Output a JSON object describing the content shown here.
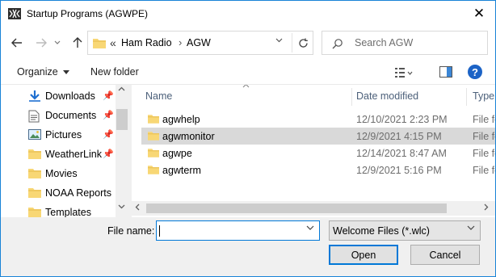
{
  "window": {
    "title": "Startup Programs (AGWPE)",
    "close_glyph": "✕"
  },
  "nav": {
    "back_icon": "arrow-left-icon",
    "forward_icon": "arrow-right-icon",
    "recent_icon": "chevron-down-icon",
    "up_icon": "arrow-up-icon",
    "breadcrumb_overflow": "«",
    "breadcrumb": [
      "Ham Radio",
      "AGW"
    ],
    "breadcrumb_separator": "›",
    "search_placeholder": "Search AGW"
  },
  "toolbar": {
    "organize_label": "Organize",
    "new_folder_label": "New folder",
    "help_label": "?"
  },
  "sidebar": {
    "items": [
      {
        "label": "Downloads",
        "icon": "downloads-icon",
        "pinned": true
      },
      {
        "label": "Documents",
        "icon": "documents-icon",
        "pinned": true
      },
      {
        "label": "Pictures",
        "icon": "pictures-icon",
        "pinned": true
      },
      {
        "label": "WeatherLink",
        "icon": "folder-icon",
        "pinned": true
      },
      {
        "label": "Movies",
        "icon": "folder-icon",
        "pinned": false
      },
      {
        "label": "NOAA Reports",
        "icon": "folder-icon",
        "pinned": false
      },
      {
        "label": "Templates",
        "icon": "folder-icon",
        "pinned": false
      }
    ]
  },
  "files": {
    "columns": {
      "name": "Name",
      "date": "Date modified",
      "type": "Type"
    },
    "rows": [
      {
        "name": "agwhelp",
        "date": "12/10/2021 2:23 PM",
        "type": "File fo",
        "selected": false
      },
      {
        "name": "agwmonitor",
        "date": "12/9/2021 4:15 PM",
        "type": "File fo",
        "selected": true
      },
      {
        "name": "agwpe",
        "date": "12/14/2021 8:47 AM",
        "type": "File fo",
        "selected": false
      },
      {
        "name": "agwterm",
        "date": "12/9/2021 5:16 PM",
        "type": "File fo",
        "selected": false
      }
    ]
  },
  "footer": {
    "file_name_label": "File name:",
    "file_name_value": "",
    "file_type_value": "Welcome Files (*.wlc)",
    "open_label": "Open",
    "cancel_label": "Cancel"
  },
  "colors": {
    "accent": "#0078d7",
    "folder": "#f8d775",
    "selection": "#d9d9d9",
    "help": "#1c63c6"
  }
}
